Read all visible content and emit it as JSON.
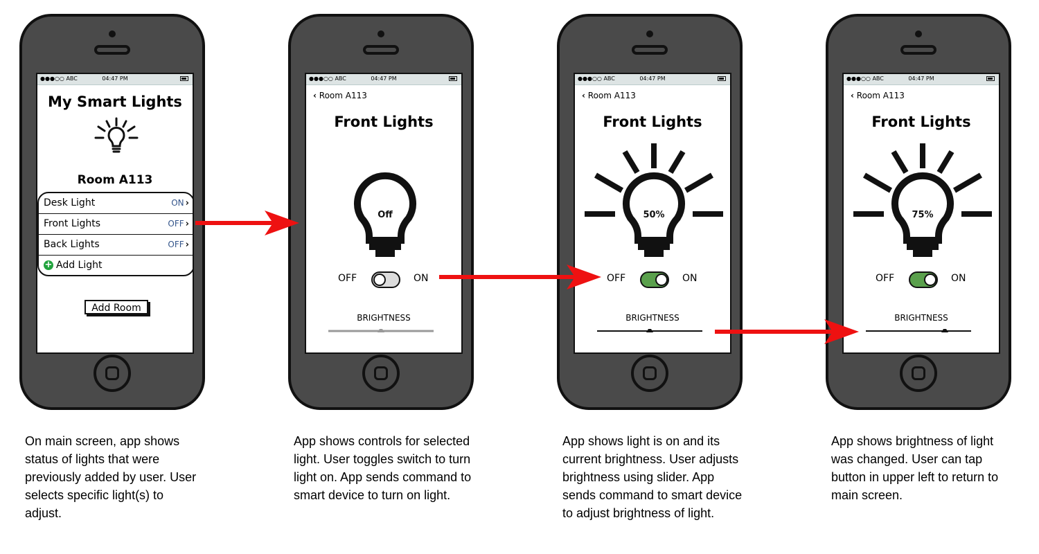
{
  "status_bar": {
    "carrier": "●●●○○ ABC",
    "time": "04:47 PM"
  },
  "screens": [
    {
      "title": "My Smart Lights",
      "room": "Room A113",
      "lights": [
        {
          "name": "Desk Light",
          "status": "ON"
        },
        {
          "name": "Front Lights",
          "status": "OFF"
        },
        {
          "name": "Back Lights",
          "status": "OFF"
        }
      ],
      "add_light": "Add Light",
      "add_room": "Add Room",
      "caption": "On main screen, app shows status of lights that were previously added by user. User selects specific light(s) to adjust."
    },
    {
      "back": "Room A113",
      "title": "Front Lights",
      "bulb_text": "Off",
      "toggle_on": false,
      "off_label": "OFF",
      "on_label": "ON",
      "brightness_label": "BRIGHTNESS",
      "brightness": 0.5,
      "slider_active": false,
      "caption": "App shows controls for selected light. User toggles switch to turn light on. App sends command to smart device to turn on light."
    },
    {
      "back": "Room A113",
      "title": "Front Lights",
      "bulb_text": "50%",
      "toggle_on": true,
      "off_label": "OFF",
      "on_label": "ON",
      "brightness_label": "BRIGHTNESS",
      "brightness": 0.5,
      "slider_active": true,
      "caption": "App shows light is on and its current brightness. User adjusts brightness using slider. App sends command to smart device to adjust brightness of light."
    },
    {
      "back": "Room A113",
      "title": "Front Lights",
      "bulb_text": "75%",
      "toggle_on": true,
      "off_label": "OFF",
      "on_label": "ON",
      "brightness_label": "BRIGHTNESS",
      "brightness": 0.75,
      "slider_active": true,
      "caption": "App shows brightness of light was changed. User can tap button in upper left to return to main screen."
    }
  ],
  "colors": {
    "arrow": "#ee1111",
    "toggle_on": "#5aa04c",
    "add_icon": "#22a33e",
    "status_text": "#34558b"
  }
}
